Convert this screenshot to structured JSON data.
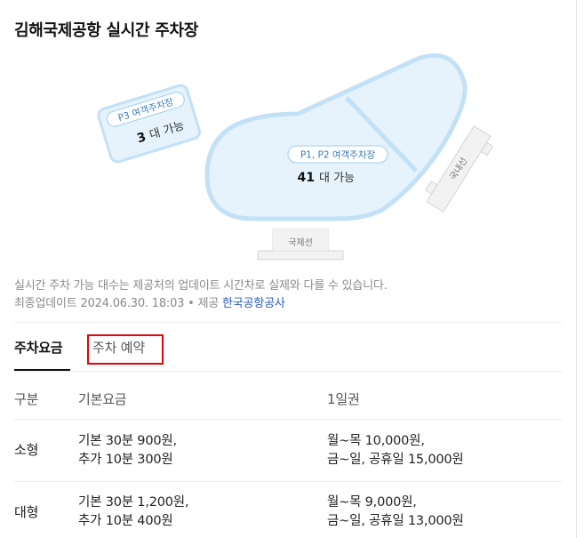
{
  "title": "김해국제공항 실시간 주차장",
  "map": {
    "p3": {
      "tag": "P3 여객주차장",
      "count": "3",
      "unit": "대 가능"
    },
    "p12": {
      "tag": "P1, P2 여객주차장",
      "count": "41",
      "unit": "대 가능"
    },
    "domestic_label": "국내선",
    "international_label": "국제선",
    "colors": {
      "lot_fill": "#e6f3fd",
      "lot_border": "#c3e1f6",
      "tag_border": "#9fcdee",
      "tag_text": "#3d7bb8"
    }
  },
  "notice": "실시간 주차 가능 대수는 제공처의 업데이트 시간차로 실제와 다를 수 있습니다.",
  "updated": {
    "prefix": "최종업데이트 2024.06.30. 18:03 • 제공 ",
    "source": "한국공항공사"
  },
  "tabs": [
    {
      "label": "주차요금",
      "active": true
    },
    {
      "label": "주차 예약",
      "active": false
    }
  ],
  "table": {
    "headers": [
      "구분",
      "기본요금",
      "1일권"
    ],
    "rows": [
      {
        "type": "소형",
        "basic": [
          "기본 30분 900원,",
          "추가 10분 300원"
        ],
        "daily": [
          "월~목 10,000원,",
          "금~일, 공휴일 15,000원"
        ]
      },
      {
        "type": "대형",
        "basic": [
          "기본 30분 1,200원,",
          "추가 10분 400원"
        ],
        "daily": [
          "월~목 9,000원,",
          "금~일, 공휴일 13,000원"
        ]
      }
    ]
  }
}
